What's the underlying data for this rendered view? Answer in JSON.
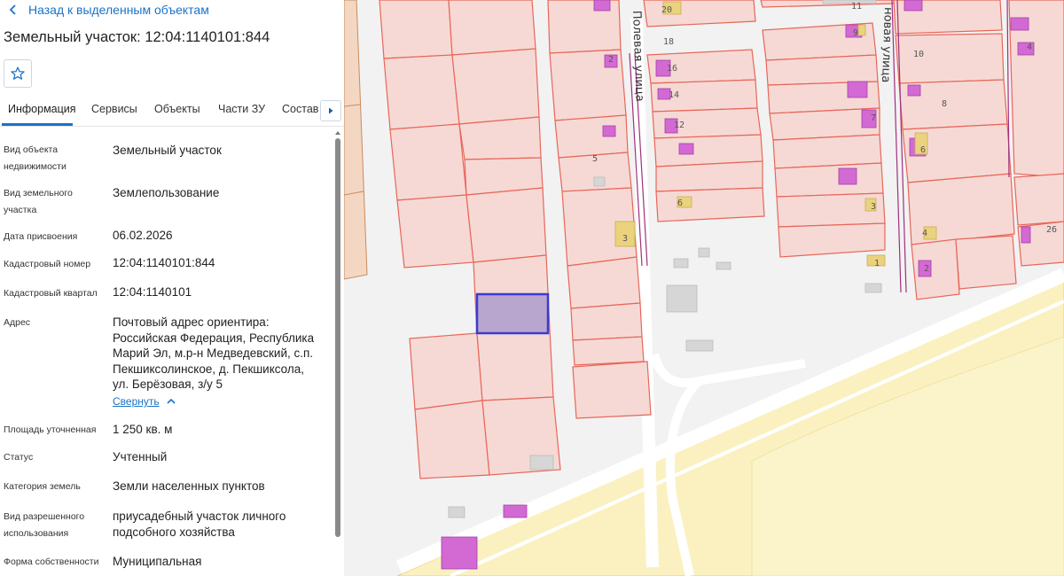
{
  "panel": {
    "back_label": "Назад к выделенным объектам",
    "title": "Земельный участок: 12:04:1140101:844",
    "tabs": [
      "Информация",
      "Сервисы",
      "Объекты",
      "Части ЗУ",
      "Состав"
    ],
    "active_tab": "Информация",
    "fields": [
      {
        "label": "Вид объекта недвижимости",
        "value": "Земельный участок"
      },
      {
        "label": "Вид земельного участка",
        "value": "Землепользование"
      },
      {
        "label": "Дата присвоения",
        "value": "06.02.2026"
      },
      {
        "label": "Кадастровый номер",
        "value": "12:04:1140101:844"
      },
      {
        "label": "Кадастровый квартал",
        "value": "12:04:1140101"
      },
      {
        "label": "Адрес",
        "value": "Почтовый адрес ориентира: Российская Федерация, Республика Марий Эл, м.р-н Медведевский, с.п. Пекшиксолинское, д. Пекшиксола, ул. Берёзовая, з/у 5"
      },
      {
        "label": "Площадь уточненная",
        "value": "1 250 кв. м"
      },
      {
        "label": "Статус",
        "value": "Учтенный"
      },
      {
        "label": "Категория земель",
        "value": "Земли населенных пунктов"
      },
      {
        "label": "Вид разрешенного использования",
        "value": "приусадебный участок личного подсобного хозяйства"
      },
      {
        "label": "Форма собственности",
        "value": "Муниципальная"
      }
    ],
    "collapse_label": "Свернуть"
  },
  "map": {
    "streets": [
      "Полевая улица",
      "новая улица"
    ],
    "house_numbers": [
      "20",
      "18",
      "16",
      "14",
      "12",
      "11",
      "9",
      "7",
      "6",
      "5",
      "3",
      "2",
      "10",
      "8",
      "6",
      "4",
      "2",
      "3",
      "1",
      "4",
      "26"
    ],
    "colors": {
      "parcel_fill": "#f6d9d4",
      "parcel_stroke": "#e8665a",
      "selected_fill": "#b9a6cf",
      "selected_stroke": "#3b3bd0",
      "building": "#d36ad4",
      "building_light": "#ead27e",
      "zone_fill": "#fbf1c0",
      "road": "#ffffff",
      "background": "#f1f1f1"
    }
  }
}
